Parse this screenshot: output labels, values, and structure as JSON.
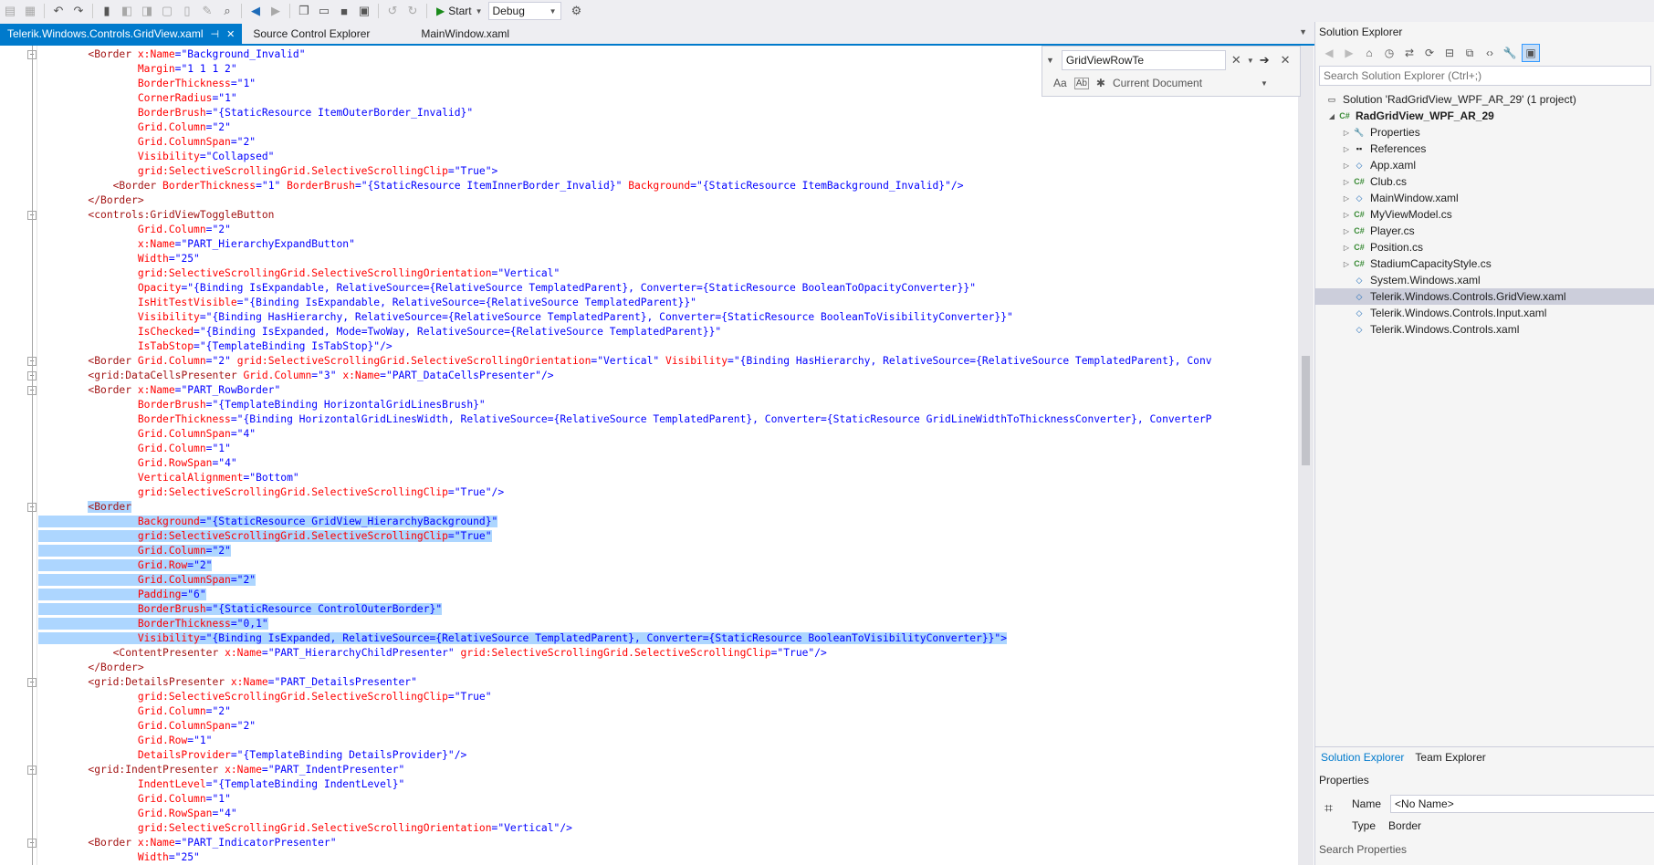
{
  "toolbar": {
    "start_label": "Start",
    "config_label": "Debug"
  },
  "tabs": [
    {
      "label": "Telerik.Windows.Controls.GridView.xaml",
      "active": true
    },
    {
      "label": "Source Control Explorer",
      "active": false
    },
    {
      "label": "MainWindow.xaml",
      "active": false
    }
  ],
  "find": {
    "query": "GridViewRowTe",
    "scope": "Current Document",
    "opt_case": "Aa",
    "opt_word": "Ab"
  },
  "code_lines": [
    {
      "i": 8,
      "tokens": [
        [
          "el",
          "<Border "
        ],
        [
          "at",
          "x:Name"
        ],
        [
          "p",
          "="
        ],
        [
          "val",
          "\"Background_Invalid\""
        ]
      ]
    },
    {
      "i": 16,
      "tokens": [
        [
          "at",
          "Margin"
        ],
        [
          "p",
          "="
        ],
        [
          "val",
          "\"1 1 1 2\""
        ]
      ]
    },
    {
      "i": 16,
      "tokens": [
        [
          "at",
          "BorderThickness"
        ],
        [
          "p",
          "="
        ],
        [
          "val",
          "\"1\""
        ]
      ]
    },
    {
      "i": 16,
      "tokens": [
        [
          "at",
          "CornerRadius"
        ],
        [
          "p",
          "="
        ],
        [
          "val",
          "\"1\""
        ]
      ]
    },
    {
      "i": 16,
      "tokens": [
        [
          "at",
          "BorderBrush"
        ],
        [
          "p",
          "="
        ],
        [
          "val",
          "\"{StaticResource ItemOuterBorder_Invalid}\""
        ]
      ]
    },
    {
      "i": 16,
      "tokens": [
        [
          "at",
          "Grid.Column"
        ],
        [
          "p",
          "="
        ],
        [
          "val",
          "\"2\""
        ]
      ]
    },
    {
      "i": 16,
      "tokens": [
        [
          "at",
          "Grid.ColumnSpan"
        ],
        [
          "p",
          "="
        ],
        [
          "val",
          "\"2\""
        ]
      ]
    },
    {
      "i": 16,
      "tokens": [
        [
          "at",
          "Visibility"
        ],
        [
          "p",
          "="
        ],
        [
          "val",
          "\"Collapsed\""
        ]
      ]
    },
    {
      "i": 16,
      "tokens": [
        [
          "at",
          "grid:SelectiveScrollingGrid.SelectiveScrollingClip"
        ],
        [
          "p",
          "="
        ],
        [
          "val",
          "\"True\""
        ],
        [
          "p",
          ">"
        ]
      ]
    },
    {
      "i": 12,
      "tokens": [
        [
          "el",
          "<Border "
        ],
        [
          "at",
          "BorderThickness"
        ],
        [
          "p",
          "="
        ],
        [
          "val",
          "\"1\" "
        ],
        [
          "at",
          "BorderBrush"
        ],
        [
          "p",
          "="
        ],
        [
          "val",
          "\"{StaticResource ItemInnerBorder_Invalid}\" "
        ],
        [
          "at",
          "Background"
        ],
        [
          "p",
          "="
        ],
        [
          "val",
          "\"{StaticResource ItemBackground_Invalid}\""
        ],
        [
          "p",
          "/>"
        ]
      ]
    },
    {
      "i": 8,
      "tokens": [
        [
          "el",
          "</Border>"
        ]
      ]
    },
    {
      "i": 8,
      "tokens": [
        [
          "el",
          "<controls:GridViewToggleButton"
        ]
      ]
    },
    {
      "i": 16,
      "tokens": [
        [
          "at",
          "Grid.Column"
        ],
        [
          "p",
          "="
        ],
        [
          "val",
          "\"2\""
        ]
      ]
    },
    {
      "i": 16,
      "tokens": [
        [
          "at",
          "x:Name"
        ],
        [
          "p",
          "="
        ],
        [
          "val",
          "\"PART_HierarchyExpandButton\""
        ]
      ]
    },
    {
      "i": 16,
      "tokens": [
        [
          "at",
          "Width"
        ],
        [
          "p",
          "="
        ],
        [
          "val",
          "\"25\""
        ]
      ]
    },
    {
      "i": 16,
      "tokens": [
        [
          "at",
          "grid:SelectiveScrollingGrid.SelectiveScrollingOrientation"
        ],
        [
          "p",
          "="
        ],
        [
          "val",
          "\"Vertical\""
        ]
      ]
    },
    {
      "i": 16,
      "tokens": [
        [
          "at",
          "Opacity"
        ],
        [
          "p",
          "="
        ],
        [
          "val",
          "\"{Binding IsExpandable, RelativeSource={RelativeSource TemplatedParent}, Converter={StaticResource BooleanToOpacityConverter}}\""
        ]
      ]
    },
    {
      "i": 16,
      "tokens": [
        [
          "at",
          "IsHitTestVisible"
        ],
        [
          "p",
          "="
        ],
        [
          "val",
          "\"{Binding IsExpandable, RelativeSource={RelativeSource TemplatedParent}}\""
        ]
      ]
    },
    {
      "i": 16,
      "tokens": [
        [
          "at",
          "Visibility"
        ],
        [
          "p",
          "="
        ],
        [
          "val",
          "\"{Binding HasHierarchy, RelativeSource={RelativeSource TemplatedParent}, Converter={StaticResource BooleanToVisibilityConverter}}\""
        ]
      ]
    },
    {
      "i": 16,
      "tokens": [
        [
          "at",
          "IsChecked"
        ],
        [
          "p",
          "="
        ],
        [
          "val",
          "\"{Binding IsExpanded, Mode=TwoWay, RelativeSource={RelativeSource TemplatedParent}}\""
        ]
      ]
    },
    {
      "i": 16,
      "tokens": [
        [
          "at",
          "IsTabStop"
        ],
        [
          "p",
          "="
        ],
        [
          "val",
          "\"{TemplateBinding IsTabStop}\""
        ],
        [
          "p",
          "/>"
        ]
      ]
    },
    {
      "i": 8,
      "tokens": [
        [
          "el",
          "<Border "
        ],
        [
          "at",
          "Grid.Column"
        ],
        [
          "p",
          "="
        ],
        [
          "val",
          "\"2\" "
        ],
        [
          "at",
          "grid:SelectiveScrollingGrid.SelectiveScrollingOrientation"
        ],
        [
          "p",
          "="
        ],
        [
          "val",
          "\"Vertical\" "
        ],
        [
          "at",
          "Visibility"
        ],
        [
          "p",
          "="
        ],
        [
          "val",
          "\"{Binding HasHierarchy, RelativeSource={RelativeSource TemplatedParent}, Conv"
        ]
      ]
    },
    {
      "i": 8,
      "tokens": [
        [
          "el",
          "<grid:DataCellsPresenter "
        ],
        [
          "at",
          "Grid.Column"
        ],
        [
          "p",
          "="
        ],
        [
          "val",
          "\"3\" "
        ],
        [
          "at",
          "x:Name"
        ],
        [
          "p",
          "="
        ],
        [
          "val",
          "\"PART_DataCellsPresenter\""
        ],
        [
          "p",
          "/>"
        ]
      ]
    },
    {
      "i": 8,
      "tokens": [
        [
          "el",
          "<Border "
        ],
        [
          "at",
          "x:Name"
        ],
        [
          "p",
          "="
        ],
        [
          "val",
          "\"PART_RowBorder\""
        ]
      ]
    },
    {
      "i": 16,
      "tokens": [
        [
          "at",
          "BorderBrush"
        ],
        [
          "p",
          "="
        ],
        [
          "val",
          "\"{TemplateBinding HorizontalGridLinesBrush}\""
        ]
      ]
    },
    {
      "i": 16,
      "tokens": [
        [
          "at",
          "BorderThickness"
        ],
        [
          "p",
          "="
        ],
        [
          "val",
          "\"{Binding HorizontalGridLinesWidth, RelativeSource={RelativeSource TemplatedParent}, Converter={StaticResource GridLineWidthToThicknessConverter}, ConverterP"
        ]
      ]
    },
    {
      "i": 16,
      "tokens": [
        [
          "at",
          "Grid.ColumnSpan"
        ],
        [
          "p",
          "="
        ],
        [
          "val",
          "\"4\""
        ]
      ]
    },
    {
      "i": 16,
      "tokens": [
        [
          "at",
          "Grid.Column"
        ],
        [
          "p",
          "="
        ],
        [
          "val",
          "\"1\""
        ]
      ]
    },
    {
      "i": 16,
      "tokens": [
        [
          "at",
          "Grid.RowSpan"
        ],
        [
          "p",
          "="
        ],
        [
          "val",
          "\"4\""
        ]
      ]
    },
    {
      "i": 16,
      "tokens": [
        [
          "at",
          "VerticalAlignment"
        ],
        [
          "p",
          "="
        ],
        [
          "val",
          "\"Bottom\""
        ]
      ]
    },
    {
      "i": 16,
      "tokens": [
        [
          "at",
          "grid:SelectiveScrollingGrid.SelectiveScrollingClip"
        ],
        [
          "p",
          "="
        ],
        [
          "val",
          "\"True\""
        ],
        [
          "p",
          "/>"
        ]
      ]
    },
    {
      "i": 8,
      "sel": true,
      "tokens": [
        [
          "el",
          "<Border"
        ]
      ]
    },
    {
      "i": 16,
      "sel": true,
      "tokens": [
        [
          "at",
          "Background"
        ],
        [
          "p",
          "="
        ],
        [
          "val",
          "\"{StaticResource GridView_HierarchyBackground}\""
        ]
      ]
    },
    {
      "i": 16,
      "sel": true,
      "tokens": [
        [
          "at",
          "grid:SelectiveScrollingGrid.SelectiveScrollingClip"
        ],
        [
          "p",
          "="
        ],
        [
          "val",
          "\"True\""
        ]
      ]
    },
    {
      "i": 16,
      "sel": true,
      "tokens": [
        [
          "at",
          "Grid.Column"
        ],
        [
          "p",
          "="
        ],
        [
          "val",
          "\"2\""
        ]
      ]
    },
    {
      "i": 16,
      "sel": true,
      "tokens": [
        [
          "at",
          "Grid.Row"
        ],
        [
          "p",
          "="
        ],
        [
          "val",
          "\"2\""
        ]
      ]
    },
    {
      "i": 16,
      "sel": true,
      "tokens": [
        [
          "at",
          "Grid.ColumnSpan"
        ],
        [
          "p",
          "="
        ],
        [
          "val",
          "\"2\""
        ]
      ]
    },
    {
      "i": 16,
      "sel": true,
      "tokens": [
        [
          "at",
          "Padding"
        ],
        [
          "p",
          "="
        ],
        [
          "val",
          "\"6\""
        ]
      ]
    },
    {
      "i": 16,
      "sel": true,
      "tokens": [
        [
          "at",
          "BorderBrush"
        ],
        [
          "p",
          "="
        ],
        [
          "val",
          "\"{StaticResource ControlOuterBorder}\""
        ]
      ]
    },
    {
      "i": 16,
      "sel": true,
      "tokens": [
        [
          "at",
          "BorderThickness"
        ],
        [
          "p",
          "="
        ],
        [
          "val",
          "\"0,1\""
        ]
      ]
    },
    {
      "i": 16,
      "sel": true,
      "tokens": [
        [
          "at",
          "Visibility"
        ],
        [
          "p",
          "="
        ],
        [
          "val",
          "\"{Binding IsExpanded, RelativeSource={RelativeSource TemplatedParent}, Converter={StaticResource BooleanToVisibilityConverter}}\""
        ],
        [
          "p",
          ">"
        ]
      ]
    },
    {
      "i": 12,
      "tokens": [
        [
          "el",
          "<ContentPresenter "
        ],
        [
          "at",
          "x:Name"
        ],
        [
          "p",
          "="
        ],
        [
          "val",
          "\"PART_HierarchyChildPresenter\" "
        ],
        [
          "at",
          "grid:SelectiveScrollingGrid.SelectiveScrollingClip"
        ],
        [
          "p",
          "="
        ],
        [
          "val",
          "\"True\""
        ],
        [
          "p",
          "/>"
        ]
      ]
    },
    {
      "i": 8,
      "tokens": [
        [
          "el",
          "</Border>"
        ]
      ]
    },
    {
      "i": 8,
      "tokens": [
        [
          "el",
          "<grid:DetailsPresenter "
        ],
        [
          "at",
          "x:Name"
        ],
        [
          "p",
          "="
        ],
        [
          "val",
          "\"PART_DetailsPresenter\""
        ]
      ]
    },
    {
      "i": 16,
      "tokens": [
        [
          "at",
          "grid:SelectiveScrollingGrid.SelectiveScrollingClip"
        ],
        [
          "p",
          "="
        ],
        [
          "val",
          "\"True\""
        ]
      ]
    },
    {
      "i": 16,
      "tokens": [
        [
          "at",
          "Grid.Column"
        ],
        [
          "p",
          "="
        ],
        [
          "val",
          "\"2\""
        ]
      ]
    },
    {
      "i": 16,
      "tokens": [
        [
          "at",
          "Grid.ColumnSpan"
        ],
        [
          "p",
          "="
        ],
        [
          "val",
          "\"2\""
        ]
      ]
    },
    {
      "i": 16,
      "tokens": [
        [
          "at",
          "Grid.Row"
        ],
        [
          "p",
          "="
        ],
        [
          "val",
          "\"1\""
        ]
      ]
    },
    {
      "i": 16,
      "tokens": [
        [
          "at",
          "DetailsProvider"
        ],
        [
          "p",
          "="
        ],
        [
          "val",
          "\"{TemplateBinding DetailsProvider}\""
        ],
        [
          "p",
          "/>"
        ]
      ]
    },
    {
      "i": 8,
      "tokens": [
        [
          "el",
          "<grid:IndentPresenter "
        ],
        [
          "at",
          "x:Name"
        ],
        [
          "p",
          "="
        ],
        [
          "val",
          "\"PART_IndentPresenter\""
        ]
      ]
    },
    {
      "i": 16,
      "tokens": [
        [
          "at",
          "IndentLevel"
        ],
        [
          "p",
          "="
        ],
        [
          "val",
          "\"{TemplateBinding IndentLevel}\""
        ]
      ]
    },
    {
      "i": 16,
      "tokens": [
        [
          "at",
          "Grid.Column"
        ],
        [
          "p",
          "="
        ],
        [
          "val",
          "\"1\""
        ]
      ]
    },
    {
      "i": 16,
      "tokens": [
        [
          "at",
          "Grid.RowSpan"
        ],
        [
          "p",
          "="
        ],
        [
          "val",
          "\"4\""
        ]
      ]
    },
    {
      "i": 16,
      "tokens": [
        [
          "at",
          "grid:SelectiveScrollingGrid.SelectiveScrollingOrientation"
        ],
        [
          "p",
          "="
        ],
        [
          "val",
          "\"Vertical\""
        ],
        [
          "p",
          "/>"
        ]
      ]
    },
    {
      "i": 8,
      "tokens": [
        [
          "el",
          "<Border "
        ],
        [
          "at",
          "x:Name"
        ],
        [
          "p",
          "="
        ],
        [
          "val",
          "\"PART_IndicatorPresenter\""
        ]
      ]
    },
    {
      "i": 16,
      "tokens": [
        [
          "at",
          "Width"
        ],
        [
          "p",
          "="
        ],
        [
          "val",
          "\"25\""
        ]
      ]
    }
  ],
  "solution_explorer": {
    "title": "Solution Explorer",
    "search_placeholder": "Search Solution Explorer (Ctrl+;)",
    "solution_label": "Solution 'RadGridView_WPF_AR_29' (1 project)",
    "project_label": "RadGridView_WPF_AR_29",
    "items": [
      {
        "label": "Properties",
        "type": "props",
        "expandable": true
      },
      {
        "label": "References",
        "type": "refs",
        "expandable": true
      },
      {
        "label": "App.xaml",
        "type": "xaml",
        "expandable": true
      },
      {
        "label": "Club.cs",
        "type": "cs",
        "expandable": true
      },
      {
        "label": "MainWindow.xaml",
        "type": "xaml",
        "expandable": true
      },
      {
        "label": "MyViewModel.cs",
        "type": "cs",
        "expandable": true
      },
      {
        "label": "Player.cs",
        "type": "cs",
        "expandable": true
      },
      {
        "label": "Position.cs",
        "type": "cs",
        "expandable": true
      },
      {
        "label": "StadiumCapacityStyle.cs",
        "type": "cs",
        "expandable": true
      },
      {
        "label": "System.Windows.xaml",
        "type": "xaml",
        "expandable": false
      },
      {
        "label": "Telerik.Windows.Controls.GridView.xaml",
        "type": "xaml",
        "expandable": false,
        "selected": true
      },
      {
        "label": "Telerik.Windows.Controls.Input.xaml",
        "type": "xaml",
        "expandable": false
      },
      {
        "label": "Telerik.Windows.Controls.xaml",
        "type": "xaml",
        "expandable": false
      }
    ],
    "tab_solution": "Solution Explorer",
    "tab_team": "Team Explorer"
  },
  "properties": {
    "title": "Properties",
    "name_label": "Name",
    "name_value": "<No Name>",
    "type_label": "Type",
    "type_value": "Border",
    "search_label": "Search Properties"
  }
}
